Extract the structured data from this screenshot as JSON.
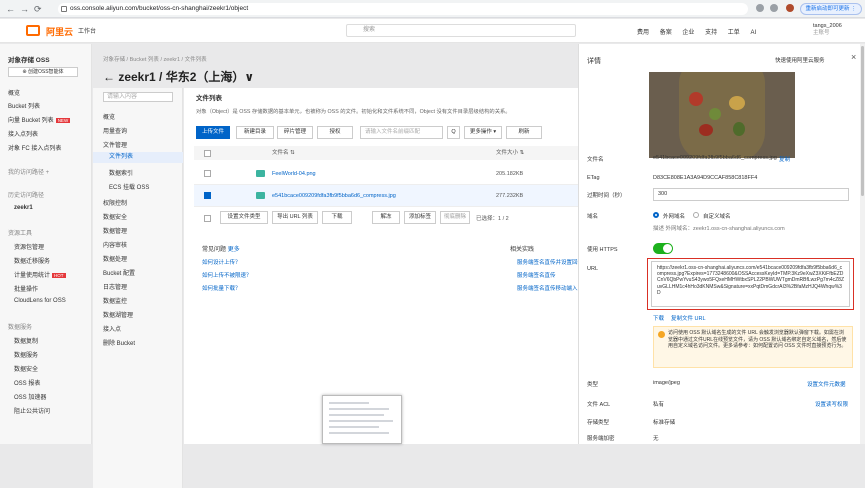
{
  "browser": {
    "back": "←",
    "forward": "→",
    "reload": "⟳",
    "url": "oss.console.aliyun.com/bucket/oss-cn-shanghai/zeekr1/object",
    "update": "重新启动即可更新 ⋮"
  },
  "topbar": {
    "logo": "阿里云",
    "workspace": "工作台",
    "search": "搜索",
    "links": [
      "费用",
      "备案",
      "企业",
      "支持",
      "工单",
      "AI"
    ],
    "user": "tangs_2006",
    "user_sub": "主账号"
  },
  "leftnav": {
    "title": "对象存储 OSS",
    "cta": "⊕ 创建OSS智能体",
    "items": [
      "概览",
      "Bucket 列表",
      "向量 Bucket 列表",
      "接入点列表",
      "对象 FC 接入点列表",
      "我的访问路径 +",
      "历史访问路径",
      "zeekr1",
      "资源工具",
      "资源包管理",
      "数据迁移服务",
      "计量使用统计",
      "批量操作",
      "CloudLens for OSS",
      "数据服务",
      "数据复制",
      "数据服务",
      "数据安全",
      "OSS 报表",
      "OSS 加速器",
      "阻止公共访问"
    ],
    "new_badge": "NEW",
    "hot_badge": "HOT"
  },
  "subnav": {
    "search": "请输入内容",
    "items": [
      "概览",
      "用量查询",
      "文件管理",
      "文件列表",
      "数据索引",
      "ECS 挂载 OSS",
      "权限控制",
      "数据安全",
      "数据管理",
      "内容审核",
      "数据处理",
      "Bucket 配置",
      "日志管理",
      "数据监控",
      "数据湖管理",
      "接入点",
      "删除 Bucket"
    ]
  },
  "header": {
    "breadcrumb": "对象存储 / Bucket 列表 / zeekr1 / 文件列表",
    "title": "←  zeekr1 / 华东2（上海）∨"
  },
  "main": {
    "title": "文件列表",
    "desc": "对象（Object）是 OSS 存储数据的基本单元，也被称为 OSS 的文件。初始化和文件系统不同，Object 没有文件目录层级结构的关系。",
    "btns": [
      "上传文件",
      "新建目录",
      "碎片管理",
      "授权",
      "Q",
      "更多操作 ▾",
      "刷新"
    ],
    "search": "请输入文件名前缀匹配",
    "col_name": "文件名 ⇅",
    "col_size": "文件大小 ⇅",
    "rows": [
      {
        "name": "FeelWorld-04.png",
        "size": "205.182KB"
      },
      {
        "name": "e541bcace009209fdfa3fb9f5bba6d6_compress.jpg",
        "size": "277.232KB"
      }
    ],
    "batch": [
      "设置文件类型",
      "导出 URL 列表",
      "下载",
      "解冻",
      "添加标签",
      "彻底删除"
    ],
    "selected": "已选择：1 / 2",
    "tips_title": "常见问题",
    "tips_more": "更多",
    "tips": [
      "如何设计上传？",
      "如何上传不被限速？",
      "如何批量下载？"
    ],
    "links_title": "相关实践",
    "links": [
      "服务端签名直传并设置回调",
      "服务端签名直传",
      "服务端签名直传移动端入口"
    ]
  },
  "drawer": {
    "title": "详情",
    "quick": "快速使用阿里云服务",
    "close": "×",
    "filename_label": "文件名",
    "filename": "e541bcace009209fdfa3fb9f5bba6d6_compress.jpg",
    "copy": "复制",
    "etag_label": "ETag",
    "etag": "D83CE808E1A3A94D9CCAF858C818FF4",
    "expire_label": "过期时间（秒）",
    "expire": "300",
    "domain_label": "域名",
    "domain_opt1": "外网域名",
    "domain_opt2": "自定义域名",
    "domain_desc": "描述  外网域名：zeekr1.oss-cn-shanghai.aliyuncs.com",
    "https_label": "使用 HTTPS",
    "url_label": "URL",
    "url": "https://zeekr1.oss-cn-shanghai.aliyuncs.com/e541bcace009209fdfa3fb9f5bba6d6_compress.jpg?Expires=1773248600&OSSAccessKeyId=TMP.3Kz9eXwZ3XKiFfbEZDCnV6QbPwYvuS43ywo5FQxeHMHWtbxSPL22PBWUWTgmDmRBfLwzPg7m4cZ8ZuvGLLHM1c4hHo3dKNMSw&Signature=xxPqtDmGdcrAI3%2BfaMzHJQ4Whqw%3D",
    "download": "下载",
    "copy_url": "复制文件 URL",
    "warn": "访问使用 OSS 默认域名生成的文件 URL 会触发浏览器默认弹窗下载。如需在浏览器中通过文件URL在线预览文件，请为 OSS 默认域名绑定自定义域名，然后使用自定义域名访问文件。更多请参考：如何配置访问 OSS 文件时直接预览行为。",
    "type_label": "类型",
    "type": "image/jpeg",
    "type_link": "设置文件元数据",
    "acl_label": "文件 ACL",
    "acl": "私有",
    "acl_link": "设置读写权限",
    "storage_label": "存储类型",
    "storage": "标准存储",
    "encrypt_label": "服务端加密",
    "encrypt": "无"
  }
}
